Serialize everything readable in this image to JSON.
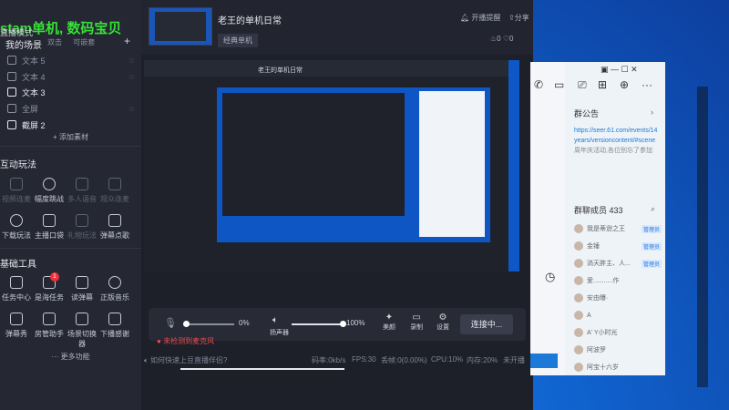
{
  "overlay": {
    "green_text": "stam单机, 数码宝贝",
    "small_text": "直播模式",
    "right_small": "窗口"
  },
  "left": {
    "scene_header": "我的场景",
    "scene_tabs": [
      "双击",
      "可嵌套"
    ],
    "add": "+",
    "materials": [
      {
        "label": "文本 5",
        "active": false
      },
      {
        "label": "文本 4",
        "active": false
      },
      {
        "label": "文本 3",
        "active": true
      },
      {
        "label": "全屏",
        "active": false
      },
      {
        "label": "截屏 2",
        "active": true
      }
    ],
    "add_material": "+ 添加素材",
    "interactive_title": "互动玩法",
    "interactive": [
      {
        "label": "视频连麦",
        "dim": true
      },
      {
        "label": "幅度跳战",
        "dim": false
      },
      {
        "label": "多人语音",
        "dim": true
      },
      {
        "label": "观众连麦",
        "dim": true
      },
      {
        "label": "下载玩法",
        "dim": false
      },
      {
        "label": "主播口袋",
        "dim": false
      },
      {
        "label": "礼物玩法",
        "dim": true
      },
      {
        "label": "弹幕点歌",
        "dim": false
      }
    ],
    "tools_title": "基础工具",
    "tools": [
      {
        "label": "任务中心"
      },
      {
        "label": "是海任务",
        "badge": "1"
      },
      {
        "label": "读弹幕"
      },
      {
        "label": "正版音乐"
      },
      {
        "label": "弹幕秀"
      },
      {
        "label": "房管助手"
      },
      {
        "label": "场景切换器"
      },
      {
        "label": "下播感谢"
      }
    ],
    "more": "··· 更多功能"
  },
  "center": {
    "room_title": "老王的单机日常",
    "category": "经典单机",
    "notice_btn": "开播提醒",
    "share_btn": "分享",
    "likes": "0",
    "hearts": "0",
    "preview_inner_title": "老王的单机日常",
    "mic_percent": "0%",
    "speaker_percent": "100%",
    "speaker_label": "扬声器",
    "beauty_label": "美颜",
    "record_label": "录制",
    "settings_label": "设置",
    "connect_btn": "连接中...",
    "mic_warning": "未检测到麦克风",
    "help_text": "如何快速上豆直播伴侣?",
    "stats": {
      "code": "码率:0kb/s",
      "fps": "FPS:30",
      "drop": "丢帧:0(0.00%)",
      "cpu": "CPU:10%",
      "mem": "内存:20%",
      "live": "未开播"
    }
  },
  "chat": {
    "notice_title": "群公告",
    "notice_link": "https://seer.61.com/events/14years/versioncontent/#scene",
    "notice_rest": "周年庆活动,各位别忘了参加",
    "members_title": "群聊成员 433",
    "members": [
      {
        "name": "我是蒂逊之王",
        "tag": "管理员"
      },
      {
        "name": "金锤",
        "tag": "管理员"
      },
      {
        "name": "淌天胖主、人...",
        "tag": "管理员"
      },
      {
        "name": "爱...........作",
        "tag": ""
      },
      {
        "name": "安由曝·",
        "tag": ""
      },
      {
        "name": "A",
        "tag": ""
      },
      {
        "name": "A' Y小时光",
        "tag": ""
      },
      {
        "name": "阿波罗",
        "tag": ""
      },
      {
        "name": "阿宝十六岁",
        "tag": ""
      }
    ]
  }
}
